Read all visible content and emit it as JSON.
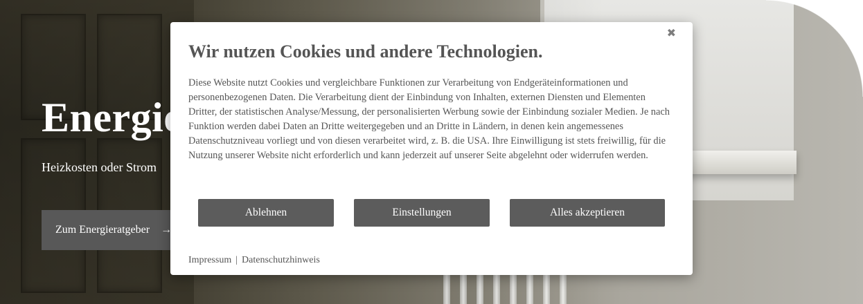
{
  "hero": {
    "title": "Energie",
    "subtitle": "Heizkosten oder Strom",
    "cta_label": "Zum Energieratgeber",
    "cta_arrow": "→"
  },
  "cookie_dialog": {
    "close_icon": "close-icon",
    "close_glyph": "✖",
    "title": "Wir nutzen Cookies und andere Technologien.",
    "body": "Diese Website nutzt Cookies und vergleichbare Funktionen zur Verarbeitung von Endgeräteinformationen und personenbezogenen Daten. Die Verarbeitung dient der Einbindung von Inhalten, externen Diensten und Elementen Dritter, der statistischen Analyse/Messung, der personalisierten Werbung sowie der Einbindung sozialer Medien. Je nach Funktion werden dabei Daten an Dritte weitergegeben und an Dritte in Ländern, in denen kein angemessenes Datenschutzniveau vorliegt und von diesen verarbeitet wird, z. B. die USA. Ihre Einwilligung ist stets freiwillig, für die Nutzung unserer Website nicht erforderlich und kann jederzeit auf unserer Seite abgelehnt oder widerrufen werden.",
    "buttons": {
      "reject": "Ablehnen",
      "settings": "Einstellungen",
      "accept": "Alles akzeptieren"
    },
    "footer": {
      "imprint": "Impressum",
      "separator": "|",
      "privacy": "Datenschutzhinweis"
    }
  },
  "colors": {
    "button_bg": "#5c5c5c",
    "text": "#555555",
    "cta_bg": "#585858"
  }
}
